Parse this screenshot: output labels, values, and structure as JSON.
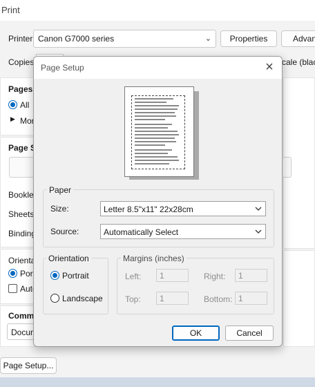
{
  "print_window": {
    "title": "Print",
    "printer_label": "Printer:",
    "printer_value": "Canon G7000 series",
    "properties_button": "Properties",
    "advanced_button": "Advan",
    "copies_label": "Copies:",
    "scale_text": "cale (black",
    "pages_heading": "Pages t",
    "pages_all": "All",
    "pages_more": "Mor",
    "page_size_heading": "Page Si",
    "booklet_label": "Booklet",
    "sheets_label": "Sheets",
    "binding_label": "Binding",
    "orientation_heading": "Orienta",
    "orientation_portrait": "Port",
    "orientation_auto": "Auto",
    "comments_heading": "Comme",
    "comments_value": "Docum",
    "page_setup_button": "Page Setup..."
  },
  "dialog": {
    "title": "Page Setup",
    "paper_group": "Paper",
    "size_label": "Size:",
    "size_value": "Letter 8.5\"x11\" 22x28cm",
    "source_label": "Source:",
    "source_value": "Automatically Select",
    "orientation_group": "Orientation",
    "portrait_label": "Portrait",
    "landscape_label": "Landscape",
    "orientation_selected": "Portrait",
    "margins_group": "Margins (inches)",
    "left_label": "Left:",
    "left_value": "1",
    "right_label": "Right:",
    "right_value": "1",
    "top_label": "Top:",
    "top_value": "1",
    "bottom_label": "Bottom:",
    "bottom_value": "1",
    "ok_button": "OK",
    "cancel_button": "Cancel"
  },
  "icons": {
    "close": "close-icon",
    "dropdown": "chevron-down-icon"
  },
  "colors": {
    "accent": "#0067c0",
    "dialog_bg": "#f0f0f0"
  }
}
